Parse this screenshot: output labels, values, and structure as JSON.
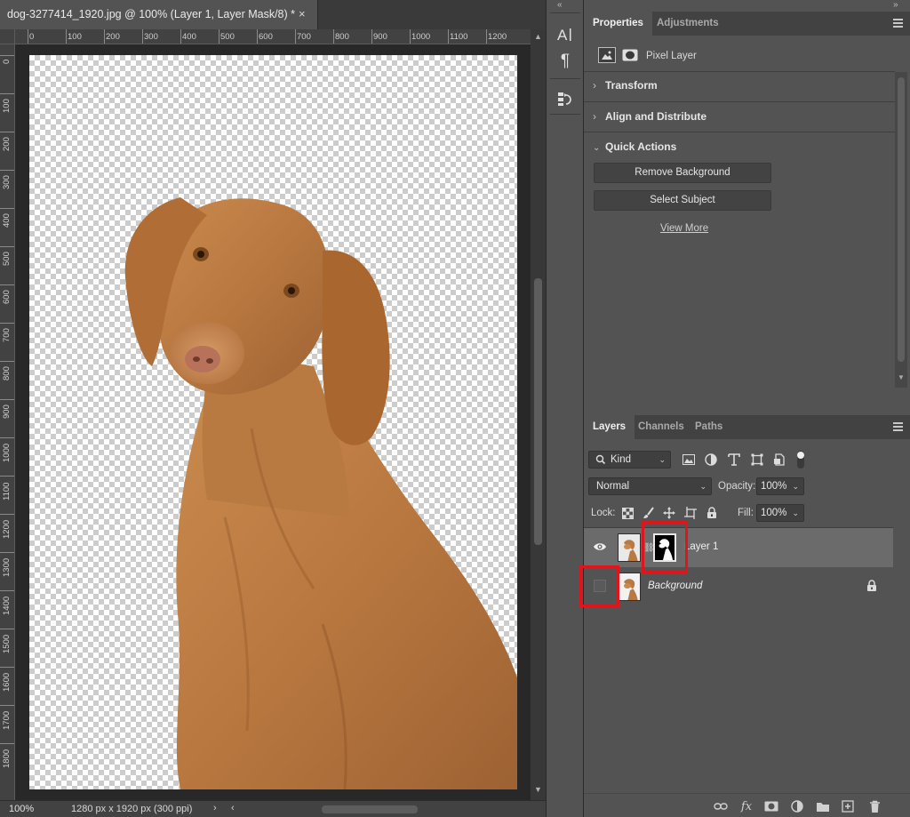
{
  "document": {
    "tab_title": "dog-3277414_1920.jpg @ 100% (Layer 1, Layer Mask/8) *",
    "close_glyph": "×",
    "ruler_top_ticks": [
      "0",
      "100",
      "200",
      "300",
      "400",
      "500",
      "600",
      "700",
      "800",
      "900",
      "1000",
      "1100",
      "1200"
    ],
    "ruler_left_ticks": [
      "0",
      "100",
      "200",
      "300",
      "400",
      "500",
      "600",
      "700",
      "800",
      "900",
      "1000",
      "1100",
      "1200",
      "1300",
      "1400",
      "1500",
      "1600",
      "1700",
      "1800"
    ]
  },
  "statusbar": {
    "zoom": "100%",
    "dimensions": "1280 px x 1920 px (300 ppi)",
    "more_glyph": "›",
    "left_glyph": "‹"
  },
  "toolstrip": {
    "collapse_glyph": "«",
    "tools": [
      "character-panel-icon",
      "paragraph-panel-icon",
      "history-panel-icon"
    ],
    "paragraph_glyph": "¶"
  },
  "right_panel": {
    "collapse_glyph": "»"
  },
  "properties": {
    "tabs": [
      "Properties",
      "Adjustments"
    ],
    "pixel_layer_label": "Pixel Layer",
    "sections": [
      "Transform",
      "Align and Distribute",
      "Quick Actions"
    ],
    "remove_background_label": "Remove Background",
    "select_subject_label": "Select Subject",
    "view_more_label": "View More"
  },
  "layers": {
    "tabs": [
      "Layers",
      "Channels",
      "Paths"
    ],
    "filter_kind": "Kind",
    "blend_mode": "Normal",
    "opacity_label": "Opacity:",
    "opacity_value": "100%",
    "lock_label": "Lock:",
    "fill_label": "Fill:",
    "fill_value": "100%",
    "items": [
      {
        "name": "Layer 1",
        "visible": true,
        "selected": true,
        "has_mask": true
      },
      {
        "name": "Background",
        "visible": false,
        "selected": false,
        "locked": true
      }
    ]
  },
  "colors": {
    "highlight": "#e0141b",
    "panel_bg": "#535353",
    "selected_row": "#6b6b6b"
  }
}
